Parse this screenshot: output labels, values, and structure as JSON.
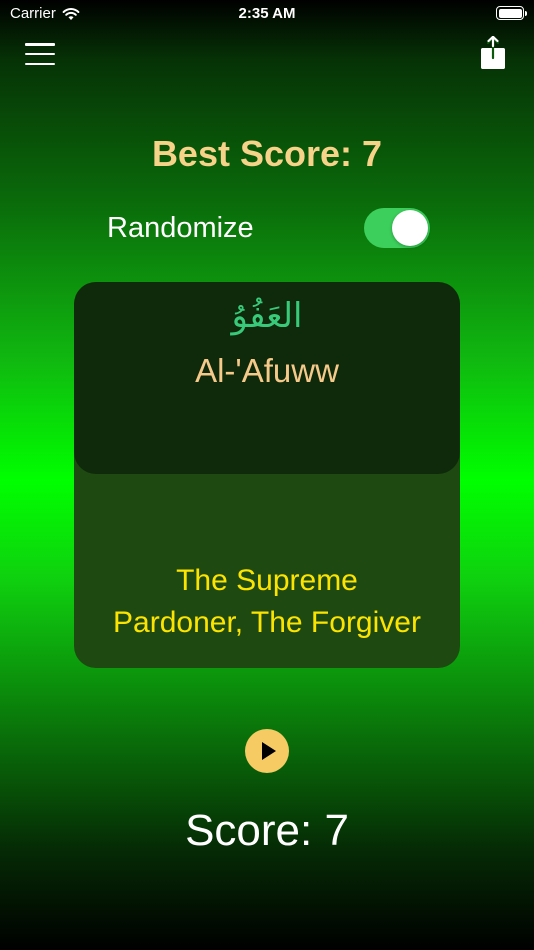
{
  "status_bar": {
    "carrier": "Carrier",
    "time": "2:35 AM"
  },
  "header": {
    "menu_icon": "hamburger-menu-icon",
    "share_icon": "share-icon"
  },
  "best_score": {
    "label": "Best Score: 7"
  },
  "randomize": {
    "label": "Randomize",
    "enabled": true
  },
  "card": {
    "arabic": "العَفُوُ",
    "transliteration": "Al-'Afuww",
    "meaning_line1": "The Supreme",
    "meaning_line2": "Pardoner, The Forgiver"
  },
  "audio": {
    "icon": "play-icon"
  },
  "score": {
    "label": "Score: 7"
  },
  "colors": {
    "accent_gold": "#f7d38a",
    "meaning_yellow": "#fde400",
    "arabic_green": "#39c97a",
    "toggle_green": "#3ccf5b"
  }
}
